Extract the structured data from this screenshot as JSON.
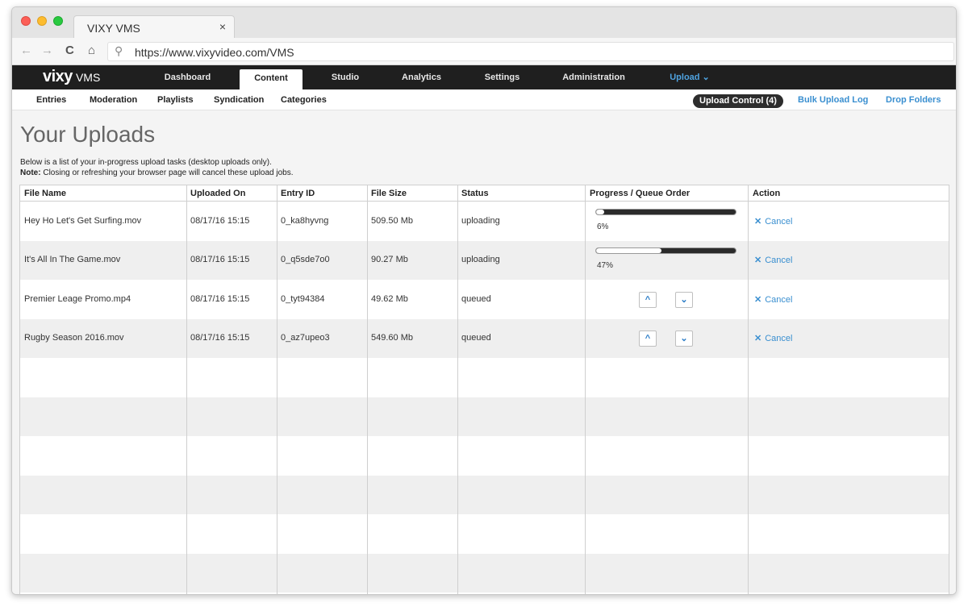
{
  "browser": {
    "tab_title": "VIXY VMS",
    "tab_close": "×",
    "url": "https://www.vixyvideo.com/VMS",
    "back_icon": "←",
    "forward_icon": "→",
    "refresh_icon": "C",
    "home_icon": "⌂",
    "search_icon": "⚲"
  },
  "logo": {
    "main": "vixy",
    "sub": "VMS"
  },
  "main_nav": {
    "dashboard": "Dashboard",
    "content": "Content",
    "studio": "Studio",
    "analytics": "Analytics",
    "settings": "Settings",
    "administration": "Administration",
    "upload": "Upload  ⌄"
  },
  "sub_nav": {
    "entries": "Entries",
    "moderation": "Moderation",
    "playlists": "Playlists",
    "syndication": "Syndication",
    "categories": "Categories",
    "upload_control": "Upload Control  (4)",
    "bulk_upload_log": "Bulk Upload Log",
    "drop_folders": "Drop Folders"
  },
  "page": {
    "title": "Your Uploads",
    "intro_line1": "Below is a list of your in-progress upload tasks (desktop uploads only).",
    "note_label": "Note:",
    "note_text": " Closing or refreshing your browser page will cancel these upload jobs."
  },
  "table": {
    "headers": {
      "file_name": "File Name",
      "uploaded_on": "Uploaded On",
      "entry_id": "Entry ID",
      "file_size": "File Size",
      "status": "Status",
      "progress": "Progress / Queue Order",
      "action": "Action"
    },
    "rows": [
      {
        "file_name": "Hey Ho Let's Get Surfing.mov",
        "uploaded_on": "08/17/16 15:15",
        "entry_id": "0_ka8hyvng",
        "file_size": "509.50 Mb",
        "status": "uploading",
        "progress": "6%",
        "progress_fraction": 0.06,
        "action": "Cancel"
      },
      {
        "file_name": "It's All In The Game.mov",
        "uploaded_on": "08/17/16 15:15",
        "entry_id": "0_q5sde7o0",
        "file_size": "90.27 Mb",
        "status": "uploading",
        "progress": "47%",
        "progress_fraction": 0.47,
        "action": "Cancel"
      },
      {
        "file_name": "Premier Leage Promo.mp4",
        "uploaded_on": "08/17/16 15:15",
        "entry_id": "0_tyt94384",
        "file_size": "49.62 Mb",
        "status": "queued",
        "action": "Cancel"
      },
      {
        "file_name": "Rugby Season 2016.mov",
        "uploaded_on": "08/17/16 15:15",
        "entry_id": "0_az7upeo3",
        "file_size": "549.60 Mb",
        "status": "queued",
        "action": "Cancel"
      }
    ],
    "move_up_icon": "^",
    "move_down_icon": "⌄",
    "cancel_icon": "✕"
  }
}
